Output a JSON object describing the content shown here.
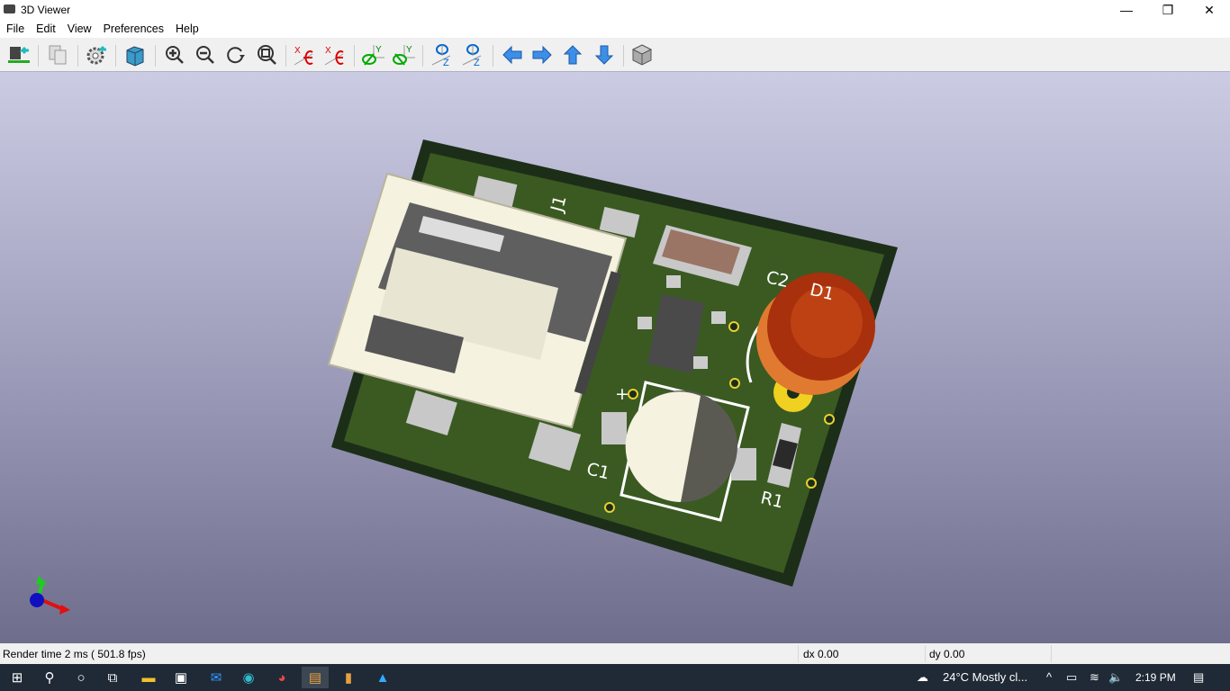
{
  "window": {
    "title": "3D Viewer",
    "minimize": "—",
    "restore": "❐",
    "close": "✕"
  },
  "menu": [
    "File",
    "Edit",
    "View",
    "Preferences",
    "Help"
  ],
  "toolbar": [
    {
      "icon": "reload-board-icon"
    },
    {
      "icon": "copy-image-icon"
    },
    {
      "icon": "settings-icon"
    },
    {
      "icon": "raytracing-cube-icon"
    },
    {
      "icon": "zoom-in-icon"
    },
    {
      "icon": "zoom-out-icon"
    },
    {
      "icon": "redraw-icon"
    },
    {
      "icon": "zoom-fit-icon"
    },
    {
      "icon": "rotate-x-cw-icon"
    },
    {
      "icon": "rotate-x-ccw-icon"
    },
    {
      "icon": "rotate-y-cw-icon"
    },
    {
      "icon": "rotate-y-ccw-icon"
    },
    {
      "icon": "rotate-z-cw-icon"
    },
    {
      "icon": "rotate-z-ccw-icon"
    },
    {
      "icon": "move-left-icon"
    },
    {
      "icon": "move-right-icon"
    },
    {
      "icon": "move-up-icon"
    },
    {
      "icon": "move-down-icon"
    },
    {
      "icon": "ortho-view-icon"
    }
  ],
  "board": {
    "labels": {
      "j1": "J1",
      "c2": "C2",
      "d1": "D1",
      "c1": "C1",
      "r1": "R1",
      "plus": "+"
    },
    "colors": {
      "pcb": "#2f4a1e",
      "edge": "#1c2e18",
      "copper": "#6e7e30",
      "silk": "#ffffff"
    }
  },
  "status": {
    "render": "Render time 2 ms ( 501.8 fps)",
    "dx": "dx 0.00",
    "dy": "dy 0.00"
  },
  "taskbar": {
    "weather": "24°C  Mostly cl...",
    "time": "2:19 PM"
  }
}
